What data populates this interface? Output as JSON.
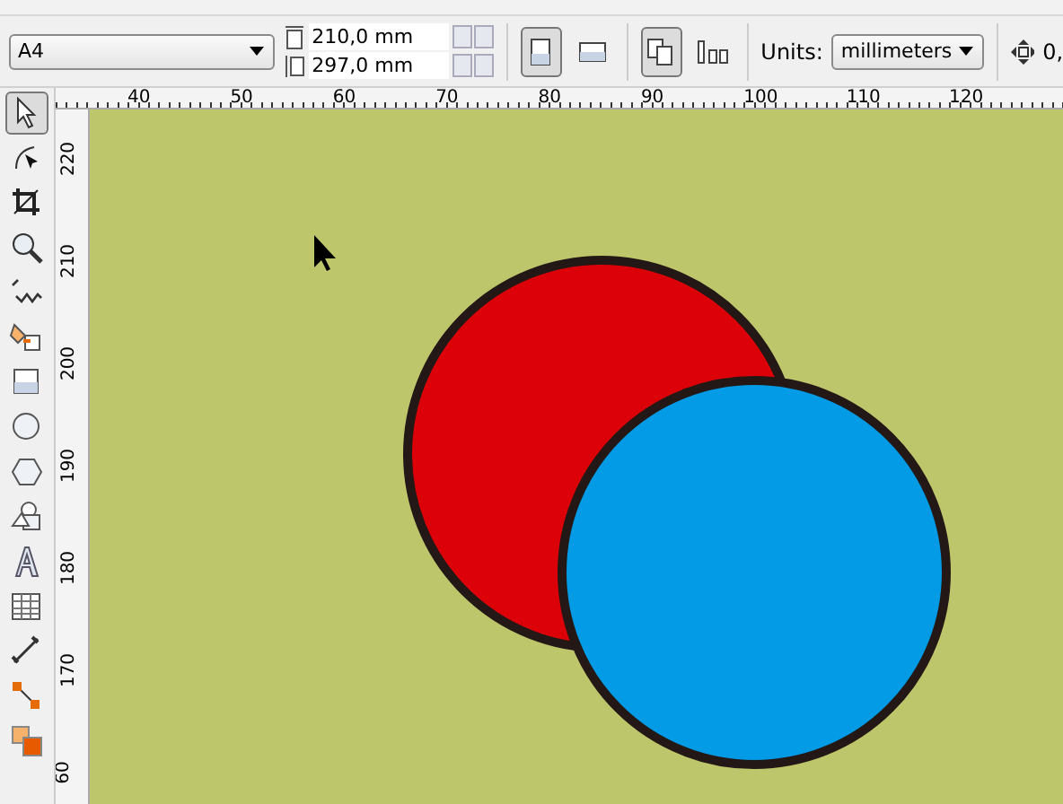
{
  "property_bar": {
    "paper_size": "A4",
    "width": "210,0 mm",
    "height": "297,0 mm",
    "orientation": [
      {
        "kind": "portrait",
        "selected": true
      },
      {
        "kind": "landscape",
        "selected": false
      }
    ],
    "page_layout": [
      {
        "kind": "all-pages",
        "selected": true
      },
      {
        "kind": "current-page",
        "selected": false
      }
    ],
    "units_label": "Units:",
    "units": "millimeters",
    "nudge": "0,"
  },
  "toolbox": [
    {
      "kind": "pick",
      "selected": true
    },
    {
      "kind": "shape",
      "selected": false
    },
    {
      "kind": "crop",
      "selected": false
    },
    {
      "kind": "zoom",
      "selected": false
    },
    {
      "kind": "freehand",
      "selected": false
    },
    {
      "kind": "smartfill",
      "selected": false
    },
    {
      "kind": "rectangle",
      "selected": false
    },
    {
      "kind": "ellipse",
      "selected": false
    },
    {
      "kind": "polygon",
      "selected": false
    },
    {
      "kind": "basicshapes",
      "selected": false
    },
    {
      "kind": "text",
      "selected": false
    },
    {
      "kind": "table",
      "selected": false
    },
    {
      "kind": "dimension",
      "selected": false
    },
    {
      "kind": "connector",
      "selected": false
    },
    {
      "kind": "fill",
      "selected": false
    }
  ],
  "horizontal_ruler": [
    "40",
    "50",
    "60",
    "70",
    "80",
    "90",
    "100",
    "110",
    "120"
  ],
  "vertical_ruler": [
    "220",
    "210",
    "200",
    "190",
    "180",
    "170",
    "60"
  ],
  "canvas": {
    "shapes": [
      {
        "kind": "circle",
        "color": "#dc0008"
      },
      {
        "kind": "circle",
        "color": "#039be5"
      }
    ]
  }
}
